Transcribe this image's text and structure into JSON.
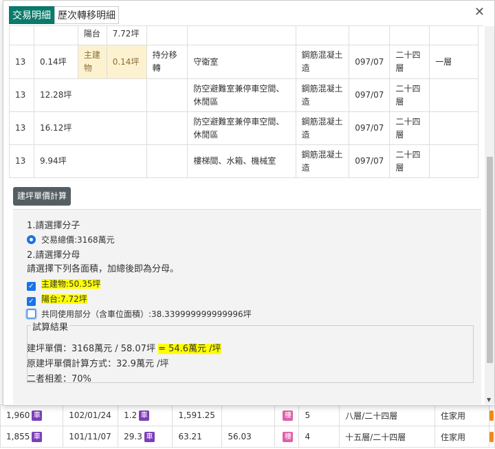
{
  "tabs": [
    {
      "label": "交易明細",
      "active": true
    },
    {
      "label": "歷次轉移明細",
      "active": false
    }
  ],
  "close_label": "✕",
  "detail_rows": [
    {
      "c1": "",
      "c2": "",
      "c3": "陽台",
      "c4": "7.72坪",
      "c5": "",
      "c6": "",
      "c7": "",
      "c8": "",
      "c9": "",
      "c10": ""
    },
    {
      "c1": "13",
      "c2": "0.14坪",
      "c3": "主建物",
      "c4": "0.14坪",
      "c5": "持分移轉",
      "c6": "守衛室",
      "c7": "鋼筋混凝土造",
      "c8": "097/07",
      "c9": "二十四層",
      "c10": "一層"
    },
    {
      "c1": "13",
      "c2": "12.28坪",
      "c3": "",
      "c4": "",
      "c5": "",
      "c6": "防空避難室兼停車空間、休閒區",
      "c7": "鋼筋混凝土造",
      "c8": "097/07",
      "c9": "二十四層",
      "c10": ""
    },
    {
      "c1": "13",
      "c2": "16.12坪",
      "c3": "",
      "c4": "",
      "c5": "",
      "c6": "防空避難室兼停車空間、休閒區",
      "c7": "鋼筋混凝土造",
      "c8": "097/07",
      "c9": "二十四層",
      "c10": ""
    },
    {
      "c1": "13",
      "c2": "9.94坪",
      "c3": "",
      "c4": "",
      "c5": "",
      "c6": "樓梯間、水箱、機械室",
      "c7": "鋼筋混凝土造",
      "c8": "097/07",
      "c9": "二十四層",
      "c10": ""
    }
  ],
  "calc": {
    "button_label": "建坪單價計算",
    "numerator_title": "1.請選擇分子",
    "numerator_option": "交易總價:3168萬元",
    "denominator_title": "2.請選擇分母",
    "denominator_hint": "請選擇下列各面積，加總後即為分母。",
    "opt_main": "主建物:50.35坪",
    "opt_balcony": "陽台:7.72坪",
    "opt_common": "共同使用部分（含車位面積）:38.339999999999996坪",
    "result_title": "試算結果",
    "result_line1_prefix": "建坪單價：3168萬元 / 58.07坪 ",
    "result_line1_hl": "= 54.6萬元 /坪",
    "result_line2": "原建坪單價計算方式：32.9萬元 /坪",
    "result_line3": "二者相差：70%"
  },
  "bg_rows": [
    {
      "price": "1,960",
      "badge": "車",
      "date": "102/01/24",
      "area": "1.2",
      "badge2": "車",
      "unit": "1,591.25",
      "extra": "",
      "tag": "樓",
      "n": "5",
      "floor": "八層/二十四層",
      "use": "住家用"
    },
    {
      "price": "1,855",
      "badge": "車",
      "date": "101/11/07",
      "area": "29.3",
      "badge2": "車",
      "unit": "63.21",
      "extra": "56.03",
      "tag": "樓",
      "n": "4",
      "floor": "十五層/二十四層",
      "use": "住家用"
    }
  ]
}
